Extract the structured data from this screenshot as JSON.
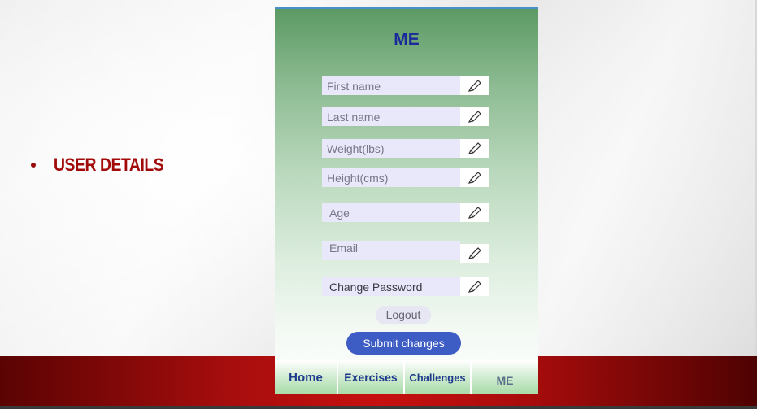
{
  "slide": {
    "bullet_text": "USER DETAILS"
  },
  "app": {
    "title": "ME",
    "fields": [
      {
        "placeholder": "First name"
      },
      {
        "placeholder": "Last name"
      },
      {
        "placeholder": "Weight(lbs)"
      },
      {
        "placeholder": "Height(cms)"
      },
      {
        "placeholder": "Age"
      },
      {
        "placeholder": "Email"
      },
      {
        "placeholder": "Change Password"
      }
    ],
    "edit_icon": "pencil-icon",
    "logout_label": "Logout",
    "submit_label": "Submit changes",
    "nav": [
      {
        "label": "Home"
      },
      {
        "label": "Exercises"
      },
      {
        "label": "Challenges"
      },
      {
        "label": "ME"
      }
    ]
  },
  "colors": {
    "bullet_red": "#a20a0a",
    "title_blue": "#1a2a9a",
    "submit_blue": "#3d5cc4",
    "band_red": "#c71010"
  }
}
